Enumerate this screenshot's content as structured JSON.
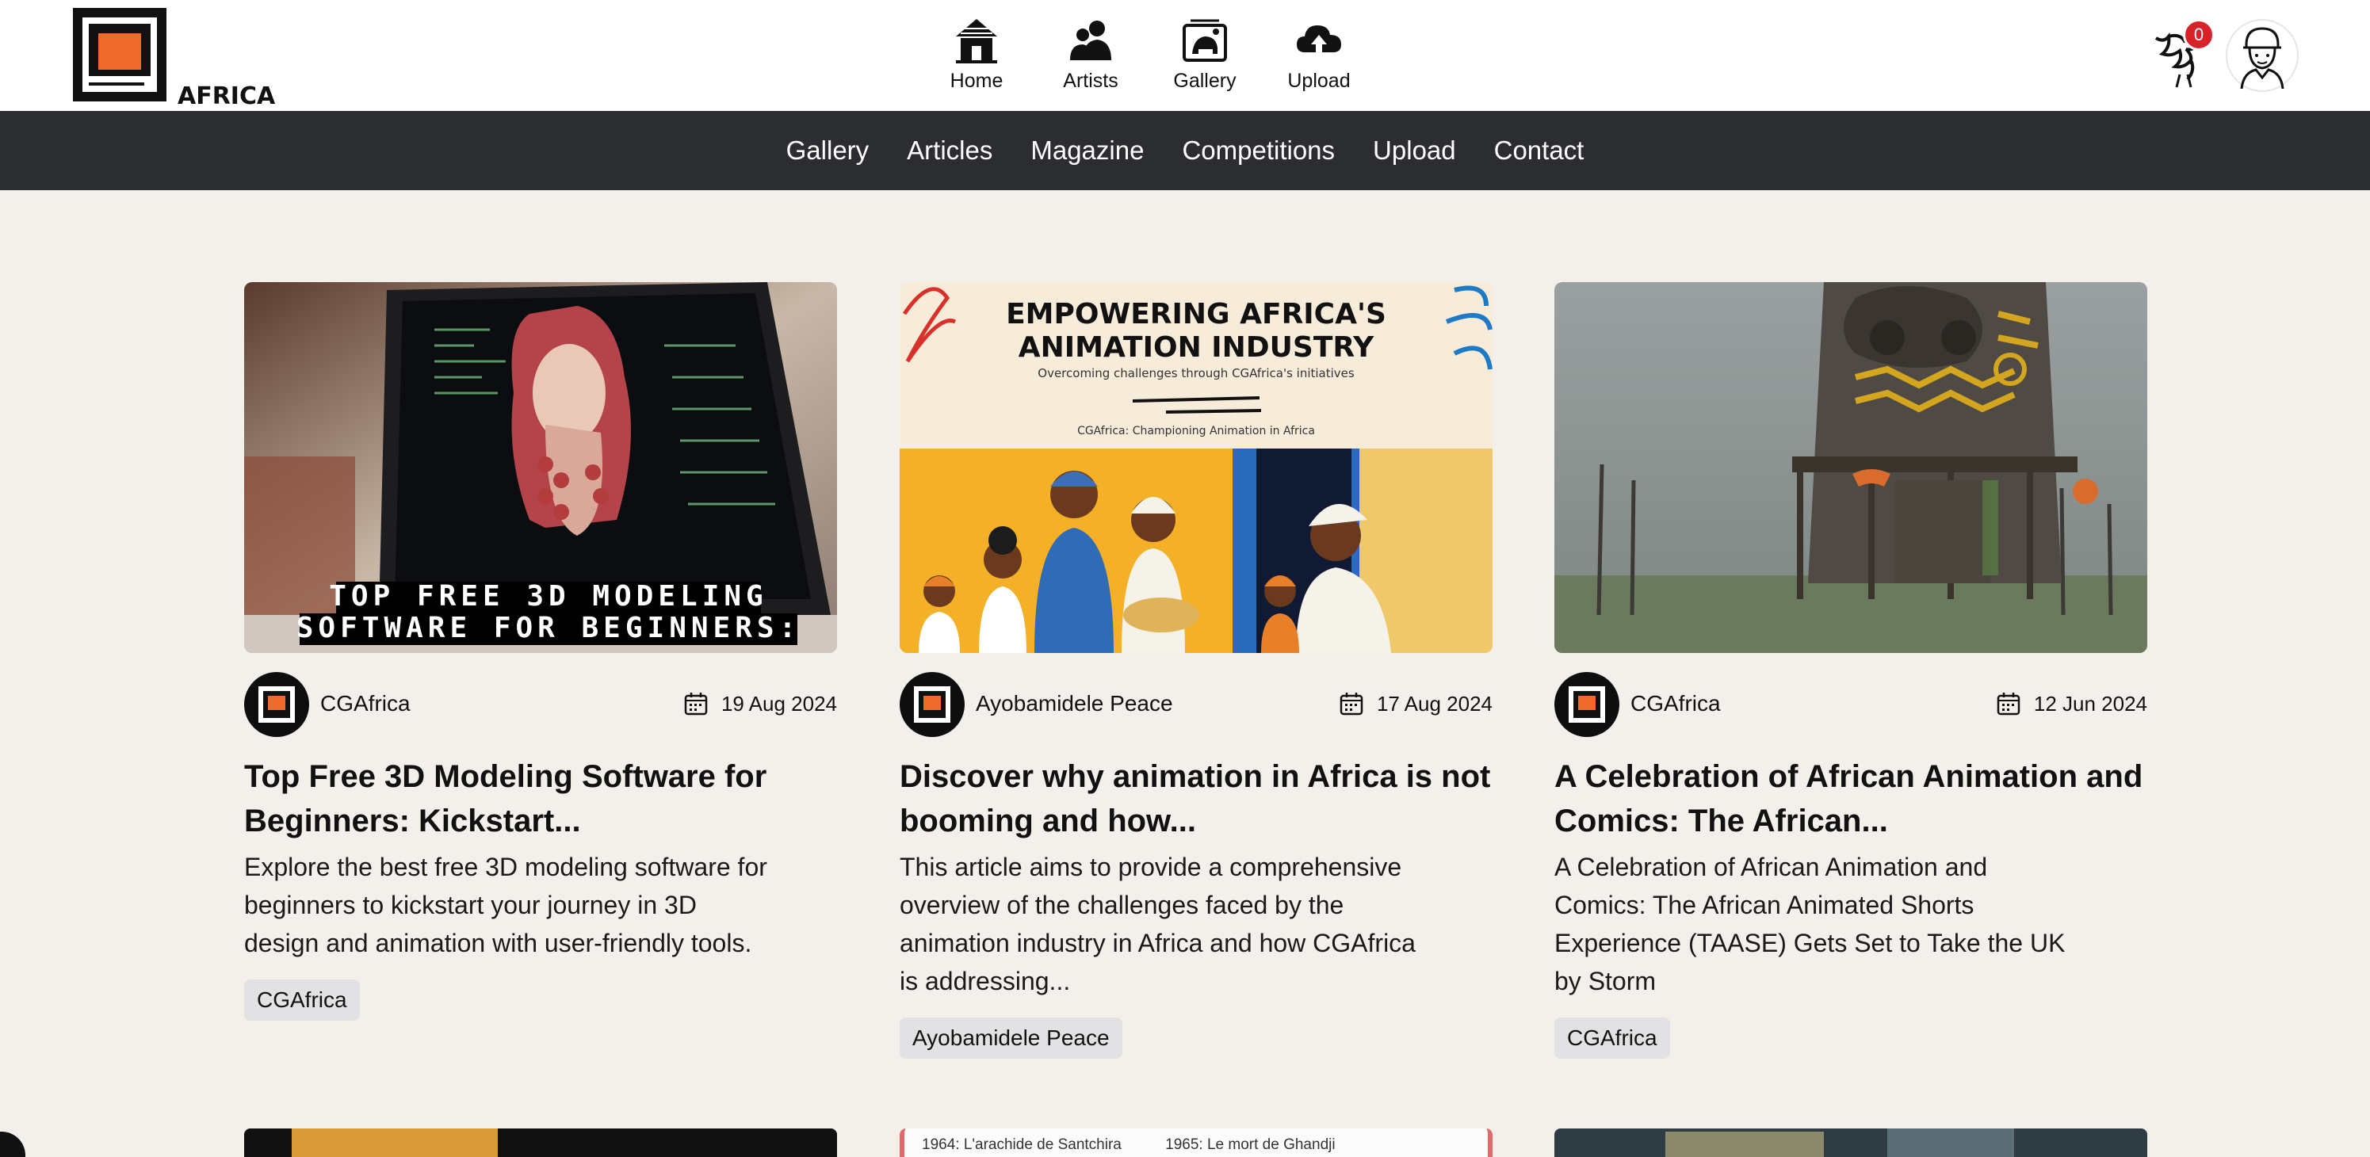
{
  "logo": {
    "text": "AFRICA"
  },
  "top_nav": [
    {
      "label": "Home",
      "icon": "hut-icon"
    },
    {
      "label": "Artists",
      "icon": "artists-icon"
    },
    {
      "label": "Gallery",
      "icon": "gallery-icon"
    },
    {
      "label": "Upload",
      "icon": "upload-cloud-icon"
    }
  ],
  "notifications": {
    "count": "0",
    "icon": "rooster-icon"
  },
  "main_nav": [
    "Gallery",
    "Articles",
    "Magazine",
    "Competitions",
    "Upload",
    "Contact"
  ],
  "cards": [
    {
      "image_caption_line1": "TOP FREE 3D MODELING",
      "image_caption_line2": "SOFTWARE FOR BEGINNERS:",
      "author": "CGAfrica",
      "date": "19 Aug 2024",
      "title": "Top Free 3D Modeling Software for Beginners: Kickstart...",
      "description": "Explore the best free 3D modeling software for beginners to kickstart your journey in 3D design and animation with user-friendly tools.",
      "tag": "CGAfrica"
    },
    {
      "image_heading_line1": "EMPOWERING AFRICA'S",
      "image_heading_line2": "ANIMATION INDUSTRY",
      "image_subheading": "Overcoming challenges through CGAfrica's initiatives",
      "image_footer": "CGAfrica: Championing Animation in Africa",
      "author": "Ayobamidele Peace",
      "date": "17 Aug 2024",
      "title": "Discover why animation in Africa is not booming and how...",
      "description": "This article aims to provide a comprehensive overview of the challenges faced by the animation industry in Africa and how CGAfrica is addressing...",
      "tag": "Ayobamidele Peace"
    },
    {
      "author": "CGAfrica",
      "date": "12 Jun 2024",
      "title": "A Celebration of African Animation and Comics: The African...",
      "description": "A Celebration of African Animation and Comics: The African Animated Shorts Experience (TAASE) Gets Set to Take the UK by Storm",
      "tag": "CGAfrica"
    }
  ],
  "peek_row": {
    "middle_text_1": "1964: L'arachide de Santchira",
    "middle_text_2": "1965: Le mort de Ghandji"
  },
  "colors": {
    "accent_orange": "#f06a2b",
    "dark_nav": "#2b2d31",
    "page_bg": "#f3efea",
    "badge_red": "#d8222a",
    "tag_bg": "#e2e2e4"
  }
}
